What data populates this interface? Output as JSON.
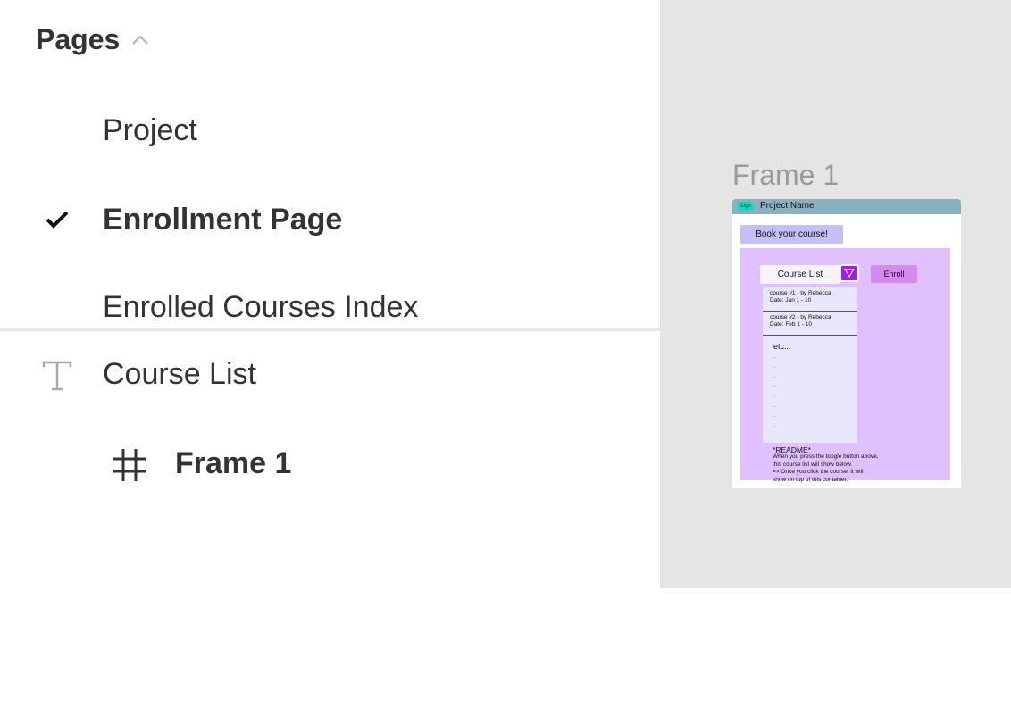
{
  "pages_panel": {
    "title": "Pages",
    "pages": [
      {
        "label": "Project",
        "active": false
      },
      {
        "label": "Enrollment Page",
        "active": true
      },
      {
        "label": "Enrolled Courses Index",
        "active": false
      }
    ]
  },
  "layers": [
    {
      "label": "Course List",
      "icon": "text-icon"
    },
    {
      "label": "Frame 1",
      "icon": "frame-icon"
    }
  ],
  "canvas": {
    "frame_title": "Frame 1",
    "frame": {
      "logo": "logo",
      "project_name": "Project Name",
      "book_button": "Book your course!",
      "course_list_button": "Course List",
      "enroll_button": "Enroll",
      "courses": [
        {
          "title": "course #1 - by Rebecca",
          "date": "Date: Jan 1 - 10"
        },
        {
          "title": "course #2 - by Rebecca",
          "date": "Date: Feb 1 - 10"
        }
      ],
      "etc": "etc...",
      "readme_title": "*README*",
      "readme_lines": [
        "When you press the toogle button above,",
        "this course list will show below.",
        "=> Once you click the course, it will",
        "show on top of this container."
      ]
    }
  },
  "colors": {
    "canvas_bg": "#e5e5e5",
    "header_bar": "#86b3c2",
    "container": "#e0c0ff",
    "toggle": "#9d1ff0",
    "enroll": "#d58af0"
  }
}
